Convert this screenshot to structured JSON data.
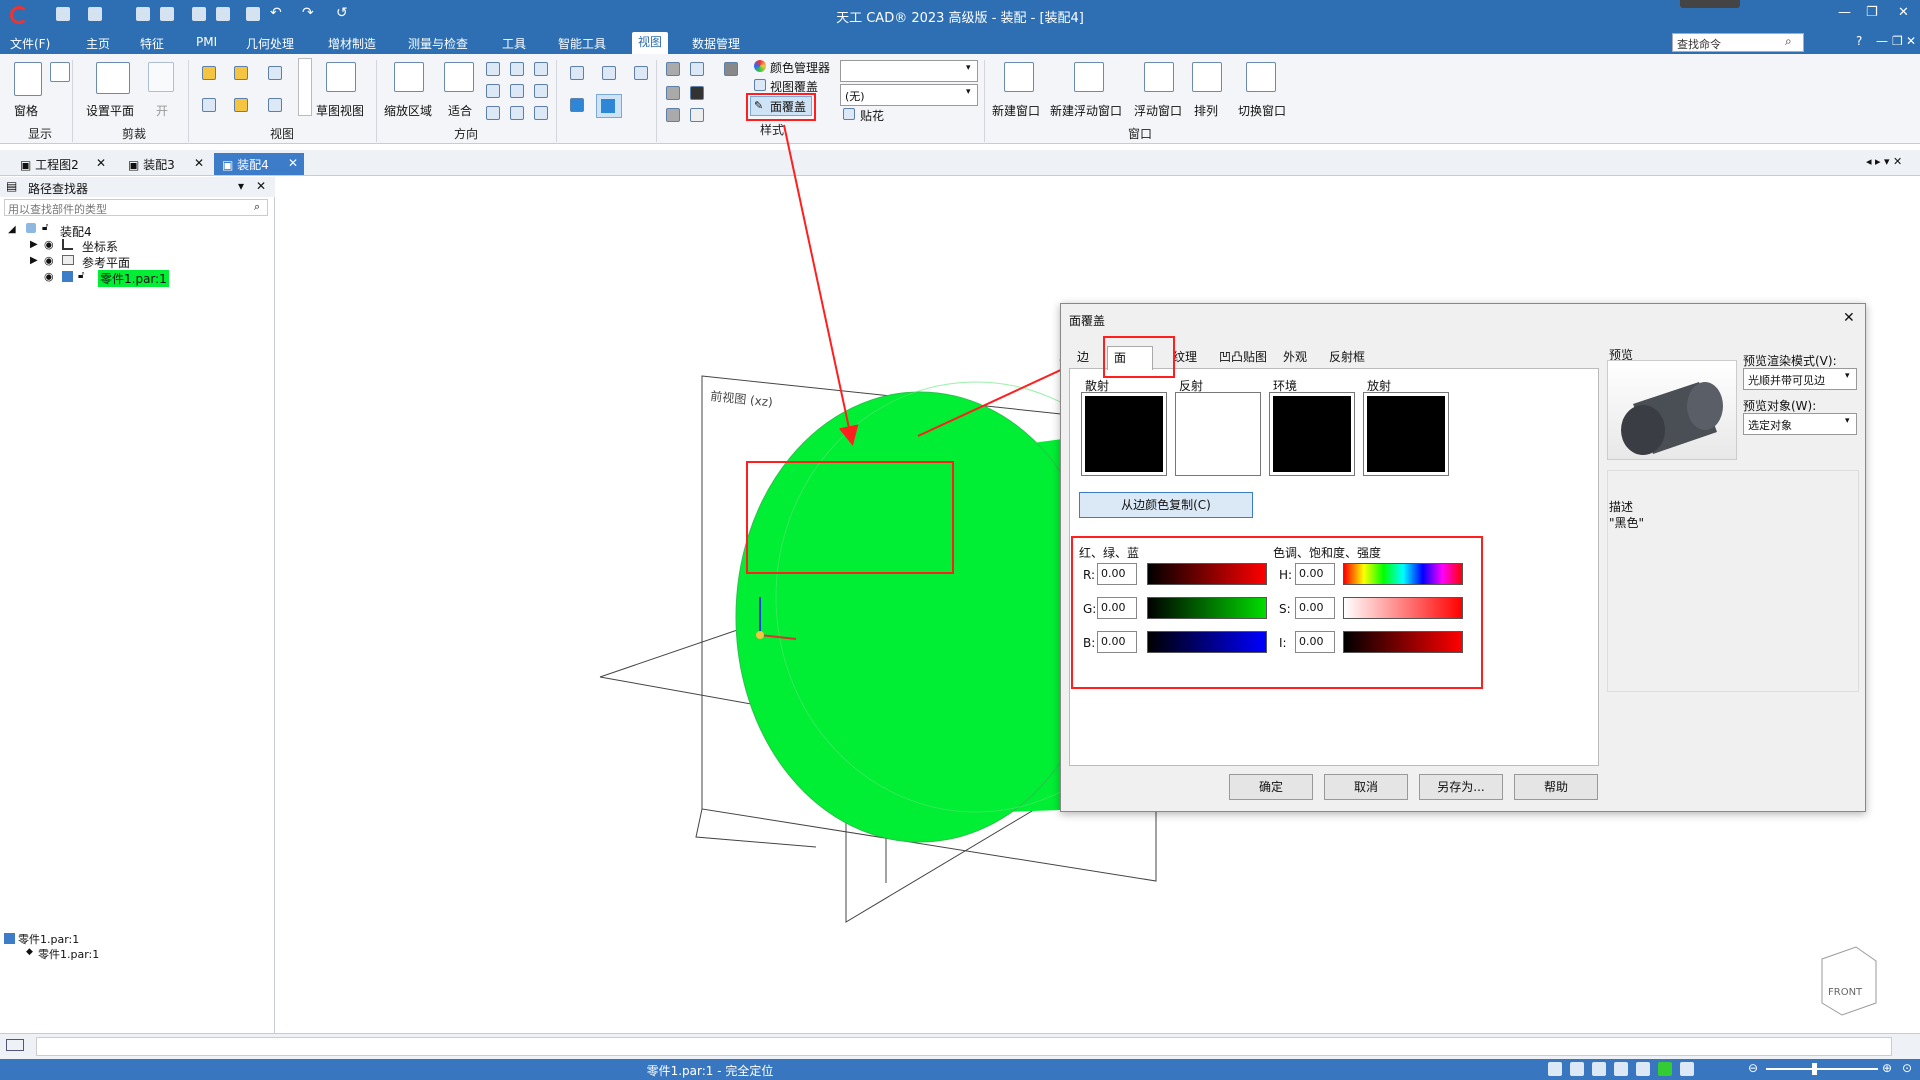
{
  "title": "天工 CAD® 2023 高级版 - 装配 - [装配4]",
  "menus": [
    "文件(F)",
    "主页",
    "特征",
    "PMI",
    "几何处理",
    "增材制造",
    "测量与检查",
    "工具",
    "智能工具",
    "视图",
    "数据管理"
  ],
  "active_menu": "视图",
  "search_placeholder": "查找命令",
  "ribbon": {
    "pane": "窗格",
    "show_group": "显示",
    "set_plane": "设置平面",
    "on": "开",
    "clip_group": "剪裁",
    "sketch_view": "草图视图",
    "view_group": "视图",
    "zoom_area": "缩放区域",
    "fit": "适合",
    "orient_group": "方向",
    "color_manager": "颜色管理器",
    "view_override": "视图覆盖",
    "face_override": "面覆盖",
    "style_group": "样式",
    "none_option": "(无)",
    "decal": "贴花",
    "new_window": "新建窗口",
    "new_float_window": "新建浮动窗口",
    "float_window": "浮动窗口",
    "arrange": "排列",
    "window_group": "窗口",
    "switch_window": "切换窗口"
  },
  "doc_tabs": [
    "工程图2",
    "装配3",
    "装配4"
  ],
  "active_doc": "装配4",
  "pathfinder": {
    "title": "路径查找器",
    "search_placeholder": "用以查找部件的类型",
    "root": "装配4",
    "items": [
      "坐标系",
      "参考平面",
      "零件1.par:1"
    ],
    "bottom_item": "零件1.par:1",
    "bottom_sub": "零件1.par:1"
  },
  "viewport": {
    "front_label": "前视图 (xz)",
    "cube_label": "FRONT"
  },
  "dialog": {
    "title": "面覆盖",
    "tabs": [
      "边",
      "面",
      "纹理",
      "凹凸贴图",
      "外观",
      "反射框"
    ],
    "active_tab": "面",
    "swatches": [
      {
        "label": "散射",
        "color": "#000000"
      },
      {
        "label": "反射",
        "color": "#ffffff"
      },
      {
        "label": "环境",
        "color": "#000000"
      },
      {
        "label": "放射",
        "color": "#000000"
      }
    ],
    "copy_button": "从边颜色复制(C)",
    "rgb_label": "红、绿、蓝",
    "hsi_label": "色调、饱和度、强度",
    "channels": [
      {
        "label": "R:",
        "value": "0.00"
      },
      {
        "label": "G:",
        "value": "0.00"
      },
      {
        "label": "B:",
        "value": "0.00"
      }
    ],
    "hsi": [
      {
        "label": "H:",
        "value": "0.00"
      },
      {
        "label": "S:",
        "value": "0.00"
      },
      {
        "label": "I:",
        "value": "0.00"
      }
    ],
    "preview_label": "预览",
    "render_mode_label": "预览渲染模式(V):",
    "render_mode": "光顺并带可见边",
    "preview_object_label": "预览对象(W):",
    "preview_object": "选定对象",
    "desc_label": "描述",
    "desc_value": "\"黑色\"",
    "buttons": [
      "确定",
      "取消",
      "另存为...",
      "帮助"
    ]
  },
  "status": "零件1.par:1 - 完全定位",
  "colors": {
    "accent": "#2d6fb2",
    "part_green": "#00ee33",
    "annotation_red": "#ff1f1f"
  }
}
